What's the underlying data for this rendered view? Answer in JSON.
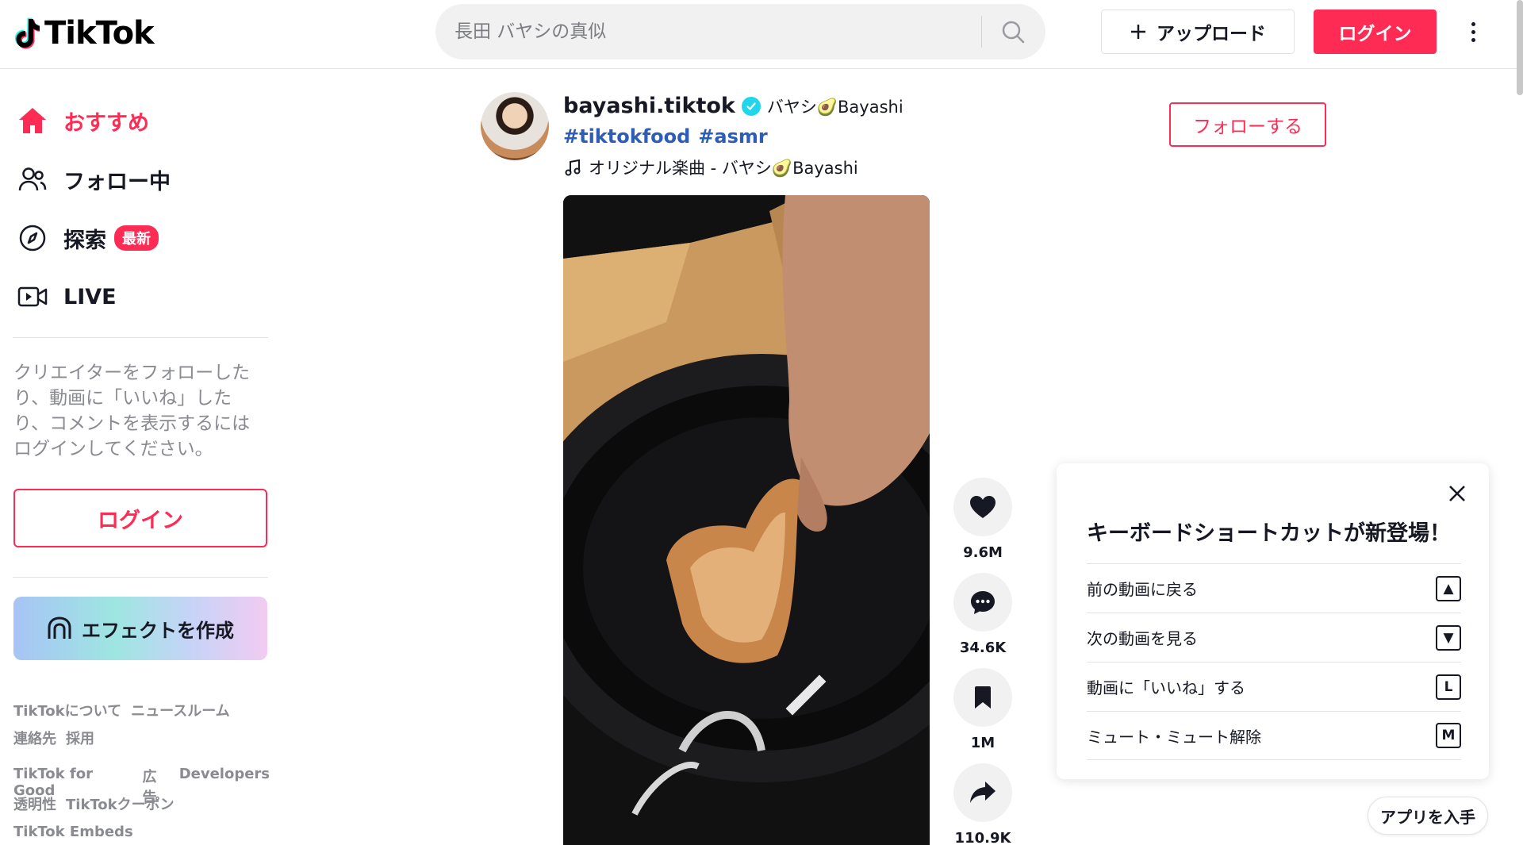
{
  "header": {
    "logo_text": "TikTok",
    "search_placeholder": "長田 バヤシの真似",
    "upload_label": "アップロード",
    "login_label": "ログイン"
  },
  "sidebar": {
    "nav": [
      {
        "label": "おすすめ",
        "icon": "home-icon",
        "active": true
      },
      {
        "label": "フォロー中",
        "icon": "people-icon"
      },
      {
        "label": "探索",
        "icon": "compass-icon",
        "badge": "最新"
      },
      {
        "label": "LIVE",
        "icon": "live-icon"
      }
    ],
    "login_prompt": "クリエイターをフォローしたり、動画に「いいね」したり、コメントを表示するにはログインしてください。",
    "login_button": "ログイン",
    "effect_button": "エフェクトを作成",
    "footer": {
      "row1": [
        "TikTokについて",
        "ニュースルーム"
      ],
      "row2": [
        "連絡先",
        "採用"
      ],
      "row3": [
        "TikTok for Good",
        "広告",
        "Developers"
      ],
      "row4": [
        "透明性",
        "TikTokクーポン"
      ],
      "row5": [
        "TikTok Embeds"
      ]
    }
  },
  "post": {
    "author_id": "bayashi.tiktok",
    "author_nickname": "バヤシ🥑Bayashi",
    "hashtags": [
      "#tiktokfood",
      "#asmr"
    ],
    "music": "オリジナル楽曲 - バヤシ🥑Bayashi",
    "follow_label": "フォローする",
    "likes": "9.6M",
    "comments": "34.6K",
    "saves": "1M",
    "shares": "110.9K"
  },
  "shortcuts": {
    "title": "キーボードショートカットが新登場！",
    "items": [
      {
        "label": "前の動画に戻る",
        "key": "▲"
      },
      {
        "label": "次の動画を見る",
        "key": "▼"
      },
      {
        "label": "動画に「いいね」する",
        "key": "L"
      },
      {
        "label": "ミュート・ミュート解除",
        "key": "M"
      }
    ]
  },
  "get_app_label": "アプリを入手",
  "colors": {
    "brand": "#fe2c55",
    "hashtag": "#2b5db9",
    "verified": "#20d5ec"
  }
}
